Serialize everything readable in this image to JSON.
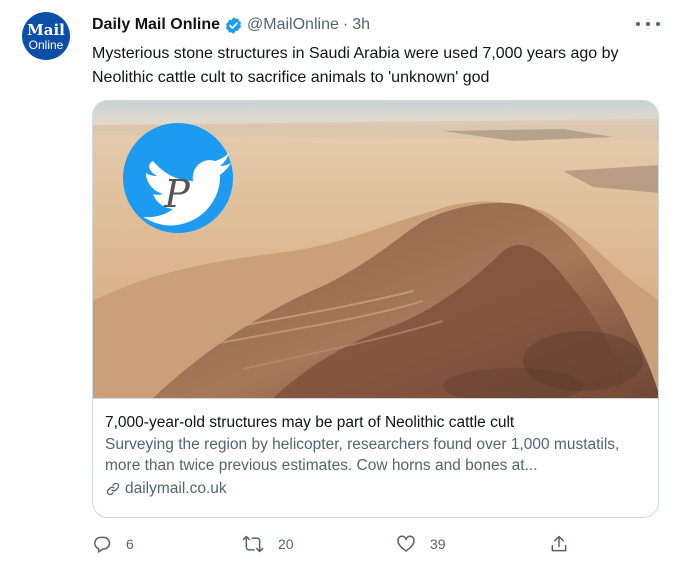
{
  "account": {
    "name": "Daily Mail Online",
    "handle": "@MailOnline",
    "separator": "·",
    "time": "3h",
    "avatar_line1": "Mail",
    "avatar_line2": "Online"
  },
  "tweet": {
    "text": "Mysterious stone structures in Saudi Arabia were used 7,000 years ago by Neolithic cattle cult to sacrifice animals to 'unknown' god"
  },
  "card": {
    "title": "7,000-year-old structures may be part of Neolithic cattle cult",
    "description": "Surveying the region by helicopter, researchers found over 1,000 mustatils, more than twice previous estimates. Cow horns and bones at...",
    "domain": "dailymail.co.uk",
    "watermark_letter": "P"
  },
  "actions": {
    "replies": "6",
    "retweets": "20",
    "likes": "39"
  },
  "icons": [
    "verified-badge-icon",
    "more-icon",
    "link-icon",
    "reply-icon",
    "retweet-icon",
    "like-icon",
    "share-icon",
    "twitter-bird-watermark-icon"
  ],
  "colors": {
    "verified": "#1d9bf0",
    "avatar": "#0c4ea8",
    "secondary_text": "#536471",
    "border": "#cfd9de"
  }
}
